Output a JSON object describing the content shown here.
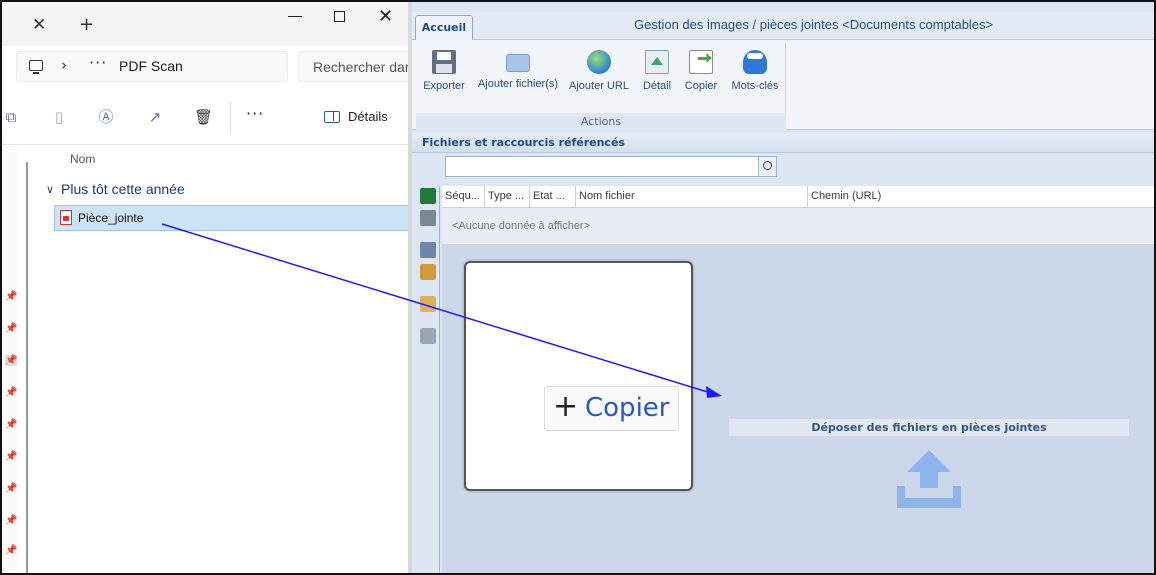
{
  "explorer": {
    "address": {
      "location": "PDF Scan"
    },
    "search": {
      "placeholder": "Rechercher dans"
    },
    "toolbar": {
      "details_label": "Détails"
    },
    "columns": {
      "name": "Nom"
    },
    "group_label": "Plus tôt cette année",
    "files": [
      {
        "name": "Pièce_jointe",
        "icon": "pdf-file-icon",
        "selected": true
      }
    ]
  },
  "app": {
    "tab_label": "Accueil",
    "title": "Gestion des images / pièces jointes <Documents comptables>",
    "ribbon": {
      "buttons": [
        {
          "label": "Exporter",
          "icon": "save-icon"
        },
        {
          "label": "Ajouter fichier(s)",
          "icon": "folder-icon"
        },
        {
          "label": "Ajouter URL",
          "icon": "globe-icon"
        },
        {
          "label": "Détail",
          "icon": "detail-icon"
        },
        {
          "label": "Copier",
          "icon": "copy-icon"
        },
        {
          "label": "Mots-clés",
          "icon": "tags-icon"
        }
      ],
      "group_label": "Actions"
    },
    "section_title": "Fichiers et raccourcis référencés",
    "grid": {
      "columns": [
        "Séqu...",
        "Type ...",
        "Etat ...",
        "Nom fichier",
        "Chemin (URL)"
      ],
      "empty_text": "<Aucune donnée à afficher>"
    },
    "drop_label": "Déposer des fichiers en pièces jointes"
  },
  "drag": {
    "action_label": "Copier"
  },
  "colors": {
    "accent": "#1e4a88",
    "selection": "#cce4f7",
    "arrow": "#1a1aff"
  }
}
